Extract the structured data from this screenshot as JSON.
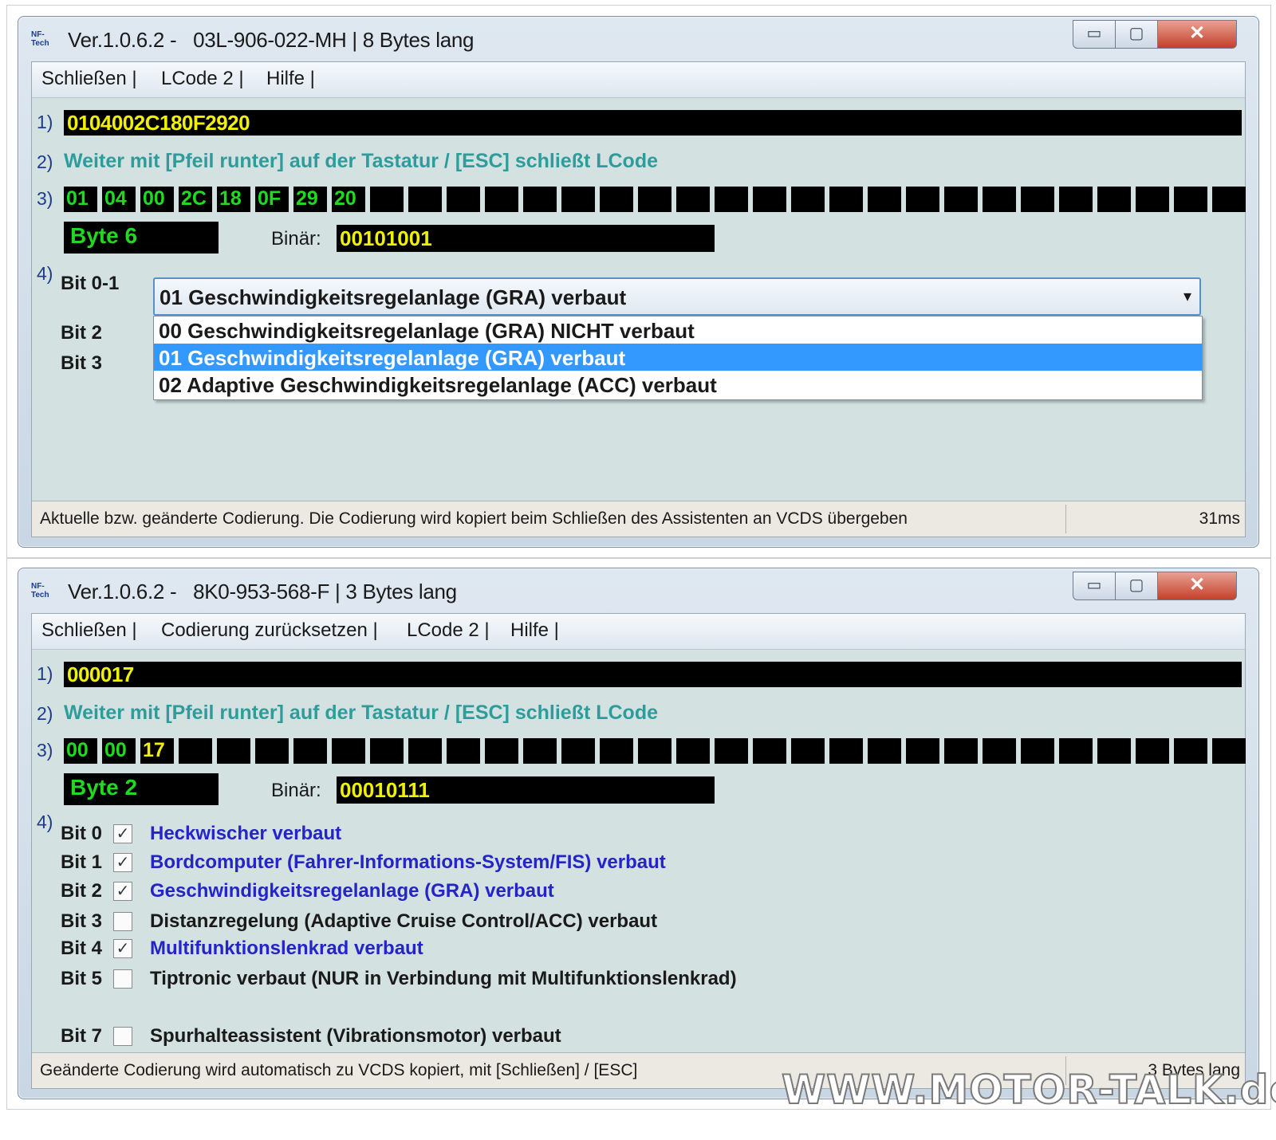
{
  "window1": {
    "title": "Ver.1.0.6.2 -   03L-906-022-MH | 8 Bytes lang",
    "app_icon": "NF-Tech",
    "controls": {
      "minimize": "▭",
      "maximize": "▢",
      "close": "✕"
    },
    "menu": [
      "Schließen |",
      "LCode 2 |",
      "Hilfe |"
    ],
    "row_labels": [
      "1)",
      "2)",
      "3)",
      "4)"
    ],
    "code": "0104002C180F2920",
    "hint": "Weiter mit [Pfeil runter] auf der Tastatur / [ESC] schließt LCode",
    "bytes": [
      "01",
      "04",
      "00",
      "2C",
      "18",
      "0F",
      "29",
      "20",
      "",
      "",
      "",
      "",
      "",
      "",
      "",
      "",
      "",
      "",
      "",
      "",
      "",
      "",
      "",
      "",
      "",
      "",
      "",
      "",
      "",
      "",
      ""
    ],
    "byte_label": "Byte 6",
    "binary_label": "Binär:",
    "binary_value": "00101001",
    "bits": [
      "Bit 0-1",
      "Bit 2",
      "Bit 3"
    ],
    "combo_value": "01 Geschwindigkeitsregelanlage (GRA) verbaut",
    "combo_arrow": "▾",
    "options": [
      {
        "label": "00 Geschwindigkeitsregelanlage (GRA) NICHT verbaut",
        "selected": false
      },
      {
        "label": "01 Geschwindigkeitsregelanlage (GRA) verbaut",
        "selected": true
      },
      {
        "label": "02 Adaptive Geschwindigkeitsregelanlage (ACC) verbaut",
        "selected": false
      }
    ],
    "status_text": "Aktuelle bzw. geänderte Codierung. Die Codierung wird kopiert beim Schließen des Assistenten an VCDS übergeben",
    "status_right": "31ms"
  },
  "window2": {
    "title": "Ver.1.0.6.2 -   8K0-953-568-F | 3 Bytes lang",
    "app_icon": "NF-Tech",
    "controls": {
      "minimize": "▭",
      "maximize": "▢",
      "close": "✕"
    },
    "menu": [
      "Schließen |",
      "Codierung zurücksetzen |",
      "LCode 2 |",
      "Hilfe |"
    ],
    "row_labels": [
      "1)",
      "2)",
      "3)",
      "4)"
    ],
    "code": "000017",
    "hint": "Weiter mit [Pfeil runter] auf der Tastatur / [ESC] schließt LCode",
    "bytes": [
      "00",
      "00",
      "17",
      "",
      "",
      "",
      "",
      "",
      "",
      "",
      "",
      "",
      "",
      "",
      "",
      "",
      "",
      "",
      "",
      "",
      "",
      "",
      "",
      "",
      "",
      "",
      "",
      "",
      "",
      "",
      ""
    ],
    "byte_label": "Byte 2",
    "binary_label": "Binär:",
    "binary_value": "00010111",
    "checkboxes": [
      {
        "bit": "Bit 0",
        "checked": true,
        "label": "Heckwischer verbaut"
      },
      {
        "bit": "Bit 1",
        "checked": true,
        "label": "Bordcomputer (Fahrer-Informations-System/FIS) verbaut"
      },
      {
        "bit": "Bit 2",
        "checked": true,
        "label": "Geschwindigkeitsregelanlage (GRA) verbaut"
      },
      {
        "bit": "Bit 3",
        "checked": false,
        "label": "Distanzregelung (Adaptive Cruise Control/ACC) verbaut"
      },
      {
        "bit": "Bit 4",
        "checked": true,
        "label": "Multifunktionslenkrad verbaut"
      },
      {
        "bit": "Bit 5",
        "checked": false,
        "label": "Tiptronic verbaut (NUR in Verbindung mit Multifunktionslenkrad)"
      },
      {
        "bit": "Bit 7",
        "checked": false,
        "label": "Spurhalteassistent (Vibrationsmotor) verbaut"
      }
    ],
    "status_text": "Geänderte Codierung wird automatisch zu VCDS kopiert, mit [Schließen] / [ESC]",
    "status_right": "3 Bytes lang"
  },
  "watermark": "WWW.MOTOR-TALK.de",
  "colors": {
    "code_yellow": "#f0f000",
    "byte_green": "#22d822",
    "hint_teal": "#2f9c9c",
    "checked_blue": "#2424c8",
    "selection_blue": "#3399ff",
    "client_bg": "#d3e1e1"
  }
}
